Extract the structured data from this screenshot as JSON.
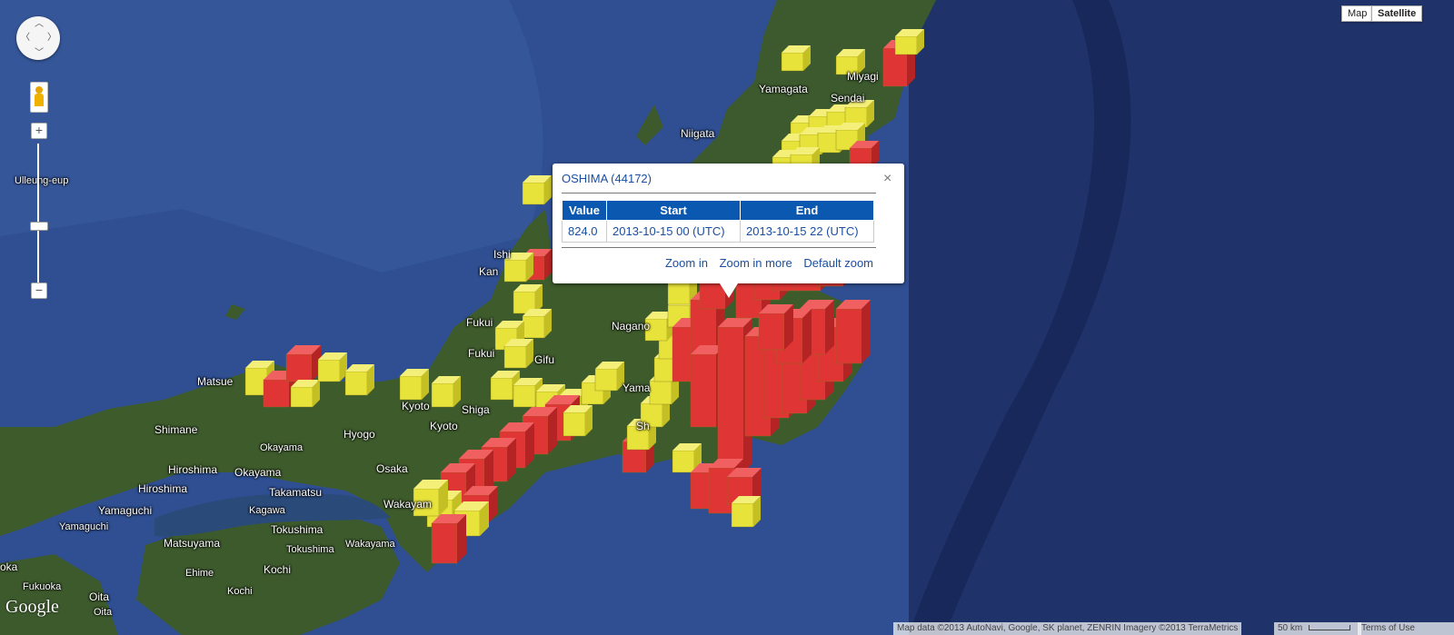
{
  "map": {
    "type_buttons": [
      {
        "label": "Map",
        "active": false
      },
      {
        "label": "Satellite",
        "active": true
      }
    ],
    "labels": [
      {
        "text": "Miyagi"
      },
      {
        "text": "Sendai"
      },
      {
        "text": "Yamagata"
      },
      {
        "text": "Niigata"
      },
      {
        "text": "Ulleung-eup"
      },
      {
        "text": "Ishi"
      },
      {
        "text": "Kan"
      },
      {
        "text": "Fukui"
      },
      {
        "text": "Fukui"
      },
      {
        "text": "Nagano"
      },
      {
        "text": "Gifu"
      },
      {
        "text": "Matsue"
      },
      {
        "text": "Kyoto"
      },
      {
        "text": "Kyoto"
      },
      {
        "text": "Shiga"
      },
      {
        "text": "Yama"
      },
      {
        "text": "Sh"
      },
      {
        "text": "Shimane"
      },
      {
        "text": "Hyogo"
      },
      {
        "text": "Okayama"
      },
      {
        "text": "Hiroshima"
      },
      {
        "text": "Okayama"
      },
      {
        "text": "Hiroshima"
      },
      {
        "text": "Osaka"
      },
      {
        "text": "Takamatsu"
      },
      {
        "text": "Kagawa"
      },
      {
        "text": "Wakayam"
      },
      {
        "text": "Yamaguchi"
      },
      {
        "text": "Yamaguchi"
      },
      {
        "text": "Tokushima"
      },
      {
        "text": "Tokushima"
      },
      {
        "text": "Wakayama"
      },
      {
        "text": "Matsuyama"
      },
      {
        "text": "Ehime"
      },
      {
        "text": "Kochi"
      },
      {
        "text": "Kochi"
      },
      {
        "text": "oka"
      },
      {
        "text": "Fukuoka"
      },
      {
        "text": "Oita"
      },
      {
        "text": "Oita"
      }
    ],
    "bar_colors": {
      "high": "#e03535",
      "low": "#e8e33a"
    }
  },
  "controls": {
    "zoom_in": "+",
    "zoom_out": "−"
  },
  "popup": {
    "title": "OSHIMA (44172)",
    "close": "×",
    "headers": [
      "Value",
      "Start",
      "End"
    ],
    "row": [
      "824.0",
      "2013-10-15 00 (UTC)",
      "2013-10-15 22 (UTC)"
    ],
    "links": [
      "Zoom in",
      "Zoom in more",
      "Default zoom"
    ]
  },
  "footer": {
    "logo": "Google",
    "attribution": "Map data ©2013 AutoNavi, Google, SK planet, ZENRIN Imagery ©2013 TerraMetrics",
    "scale": "50 km",
    "terms": "Terms of Use"
  }
}
